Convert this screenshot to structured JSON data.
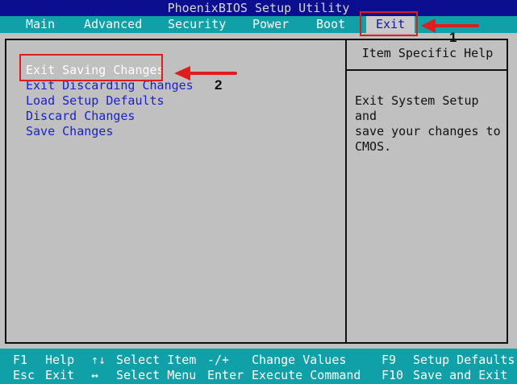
{
  "title": "PhoenixBIOS Setup Utility",
  "tabs": [
    {
      "label": "Main"
    },
    {
      "label": "Advanced"
    },
    {
      "label": "Security"
    },
    {
      "label": "Power"
    },
    {
      "label": "Boot"
    },
    {
      "label": "Exit",
      "active": true
    }
  ],
  "menu_items": [
    "Exit Saving Changes",
    "Exit Discarding Changes",
    "Load Setup Defaults",
    "Discard Changes",
    "Save Changes"
  ],
  "help": {
    "title": "Item Specific Help",
    "text": "Exit System Setup and\nsave your changes to\nCMOS."
  },
  "footer": [
    {
      "key": "F1",
      "desc": "Help"
    },
    {
      "key": "↑↓",
      "desc": "Select Item"
    },
    {
      "key": "-/+",
      "desc": "Change Values"
    },
    {
      "key": "F9",
      "desc": "Setup Defaults"
    },
    {
      "key": "Esc",
      "desc": "Exit"
    },
    {
      "key": "↔",
      "desc": "Select Menu"
    },
    {
      "key": "Enter",
      "desc": "Execute Command"
    },
    {
      "key": "F10",
      "desc": "Save and Exit"
    }
  ],
  "annotations": {
    "step1": "1",
    "step2": "2"
  },
  "colors": {
    "bios_blue": "#0d0f8f",
    "bios_cyan": "#10a0a8",
    "bios_gray": "#c0c0c0",
    "annotation_red": "#e21b1b"
  }
}
